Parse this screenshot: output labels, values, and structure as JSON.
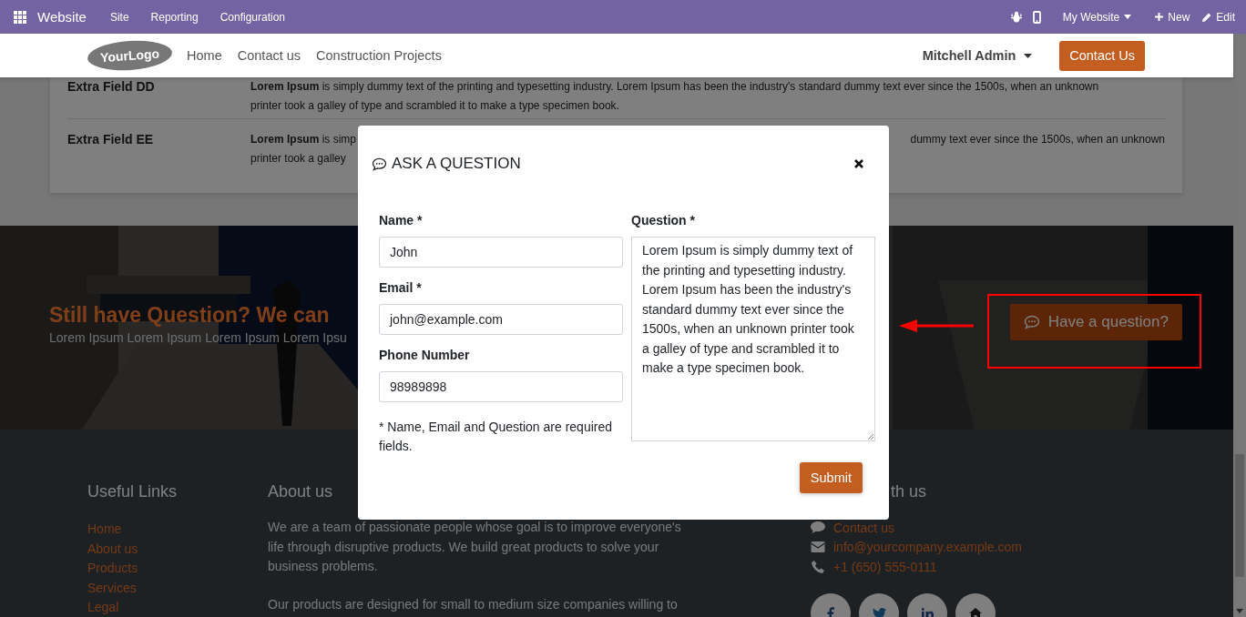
{
  "admin_bar": {
    "app": "Website",
    "menu": [
      "Site",
      "Reporting",
      "Configuration"
    ],
    "website_switch": "My Website",
    "new": "New",
    "edit": "Edit"
  },
  "header": {
    "logo": "YourLogo",
    "nav": [
      "Home",
      "Contact us",
      "Construction Projects"
    ],
    "user": "Mitchell Admin",
    "cta": "Contact Us"
  },
  "fields": [
    {
      "kind": "full",
      "label": "Extra Field DD",
      "lines": [
        "**Lorem Ipsum** is simply dummy text of the printing and typesetting industry. Lorem Ipsum has been the industry's standard dummy text ever since the 1500s, when an unknown",
        "printer took a galley of type and scrambled it to make a type specimen book."
      ]
    },
    {
      "kind": "covered",
      "label": "Extra Field EE",
      "line_start": "**Lorem Ipsum** is simp",
      "line_end": "dummy text ever since the 1500s, when an unknown",
      "line_2": "printer took a galley"
    }
  ],
  "banner": {
    "title": "Still have Question? We can",
    "text": "Lorem Ipsum Lorem Ipsum Lorem Ipsum Lorem Ipsu",
    "button": "Have a question?"
  },
  "footer": {
    "links_title": "Useful Links",
    "links": [
      "Home",
      "About us",
      "Products",
      "Services",
      "Legal"
    ],
    "about_title": "About us",
    "about": [
      "We are a team of passionate people whose goal is to improve everyone's life through disruptive products. We build great products to solve your business problems.",
      "Our products are designed for small to medium size companies willing to"
    ],
    "connect_title": "th us",
    "contacts": [
      {
        "kind": "chat",
        "text": "Contact us"
      },
      {
        "kind": "mail",
        "text": "info@yourcompany.example.com"
      },
      {
        "kind": "phone",
        "text": "+1 (650) 555-0111"
      }
    ],
    "social": [
      {
        "kind": "facebook"
      },
      {
        "kind": "twitter"
      },
      {
        "kind": "linkedin"
      },
      {
        "kind": "home"
      }
    ]
  },
  "modal": {
    "title": "ASK A QUESTION",
    "fields": [
      {
        "label": "Name *",
        "value": "John"
      },
      {
        "label": "Email *",
        "value": "john@example.com"
      },
      {
        "label": "Phone Number",
        "value": "98989898"
      }
    ],
    "note": "* Name, Email and Question are required fields.",
    "question": {
      "label": "Question *",
      "value": "Lorem Ipsum is simply dummy text of the printing and typesetting industry. Lorem Ipsum has been the industry's standard dummy text ever since the 1500s, when an unknown printer took a galley of type and scrambled it to make a type specimen book."
    },
    "submit": "Submit"
  }
}
